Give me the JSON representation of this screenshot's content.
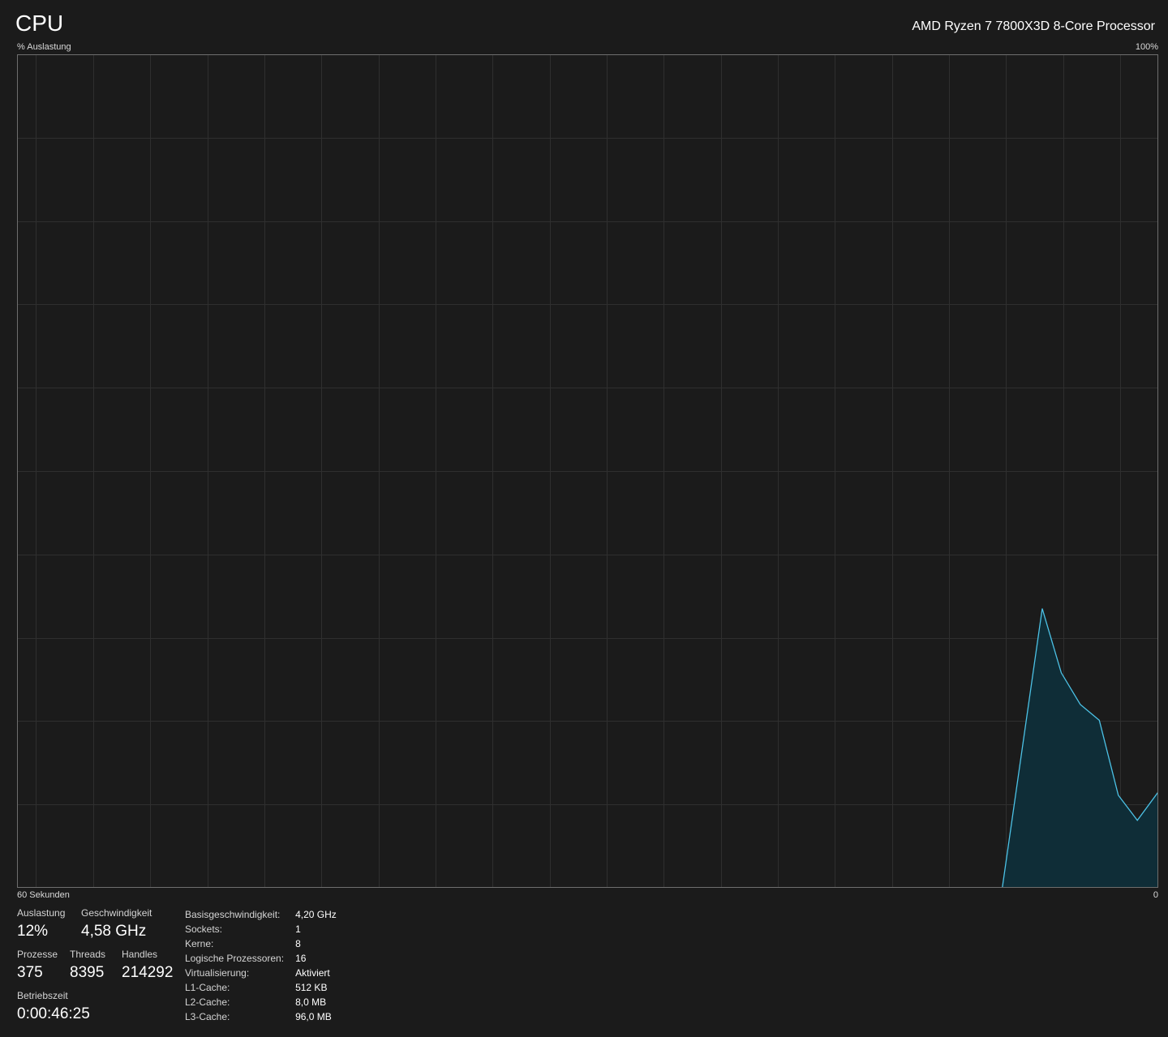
{
  "header": {
    "title": "CPU",
    "cpu_model": "AMD Ryzen 7 7800X3D 8-Core Processor"
  },
  "graph": {
    "y_label": "% Auslastung",
    "y_max_label": "100%",
    "x_label": "60 Sekunden",
    "x_min_label": "0",
    "colors": {
      "line": "#4cc2e6",
      "fill": "#0f2d37",
      "grid": "#2f2f2f",
      "border": "#6e6e6e",
      "background": "#1b1b1b"
    }
  },
  "chart_data": {
    "type": "area",
    "xlabel": "60 Sekunden",
    "ylabel": "% Auslastung",
    "xlim": [
      60,
      0
    ],
    "ylim": [
      0,
      100
    ],
    "grid": true,
    "x": [
      8.2,
      6.1,
      5.1,
      4.1,
      3.1,
      2.1,
      1.1,
      0
    ],
    "y": [
      0,
      33.5,
      25.8,
      22.0,
      20.1,
      11.1,
      8.1,
      11.5
    ]
  },
  "stats": {
    "auslastung_label": "Auslastung",
    "auslastung_value": "12%",
    "geschwindigkeit_label": "Geschwindigkeit",
    "geschwindigkeit_value": "4,58 GHz",
    "prozesse_label": "Prozesse",
    "prozesse_value": "375",
    "threads_label": "Threads",
    "threads_value": "8395",
    "handles_label": "Handles",
    "handles_value": "214292",
    "betriebszeit_label": "Betriebszeit",
    "betriebszeit_value": "0:00:46:25"
  },
  "details": [
    {
      "key": "Basisgeschwindigkeit:",
      "value": "4,20 GHz"
    },
    {
      "key": "Sockets:",
      "value": "1"
    },
    {
      "key": "Kerne:",
      "value": "8"
    },
    {
      "key": "Logische Prozessoren:",
      "value": "16"
    },
    {
      "key": "Virtualisierung:",
      "value": "Aktiviert"
    },
    {
      "key": "L1-Cache:",
      "value": "512 KB"
    },
    {
      "key": "L2-Cache:",
      "value": "8,0 MB"
    },
    {
      "key": "L3-Cache:",
      "value": "96,0 MB"
    }
  ]
}
